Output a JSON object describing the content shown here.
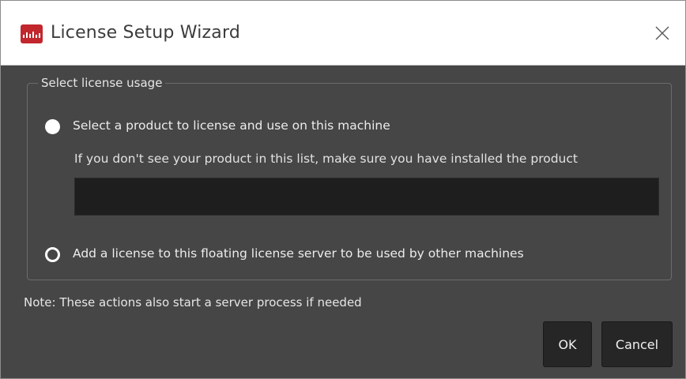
{
  "window": {
    "title": "License Setup Wizard",
    "app_icon": "waveform-icon",
    "close_icon": "close-icon"
  },
  "group": {
    "legend": "Select license usage",
    "options": [
      {
        "label": "Select a product to license and use on this machine",
        "selected": true,
        "hint": "If you don't see your product in this list, make sure you have installed the product"
      },
      {
        "label": "Add a license to this floating license server to be used by other machines",
        "selected": false
      }
    ],
    "product_list_items": []
  },
  "note": "Note: These actions also start a server process if needed",
  "buttons": {
    "ok": "OK",
    "cancel": "Cancel"
  },
  "colors": {
    "dialog_background": "#464646",
    "list_background": "#1e1e1e",
    "button_background": "#262626",
    "app_icon": "#c1272d"
  }
}
